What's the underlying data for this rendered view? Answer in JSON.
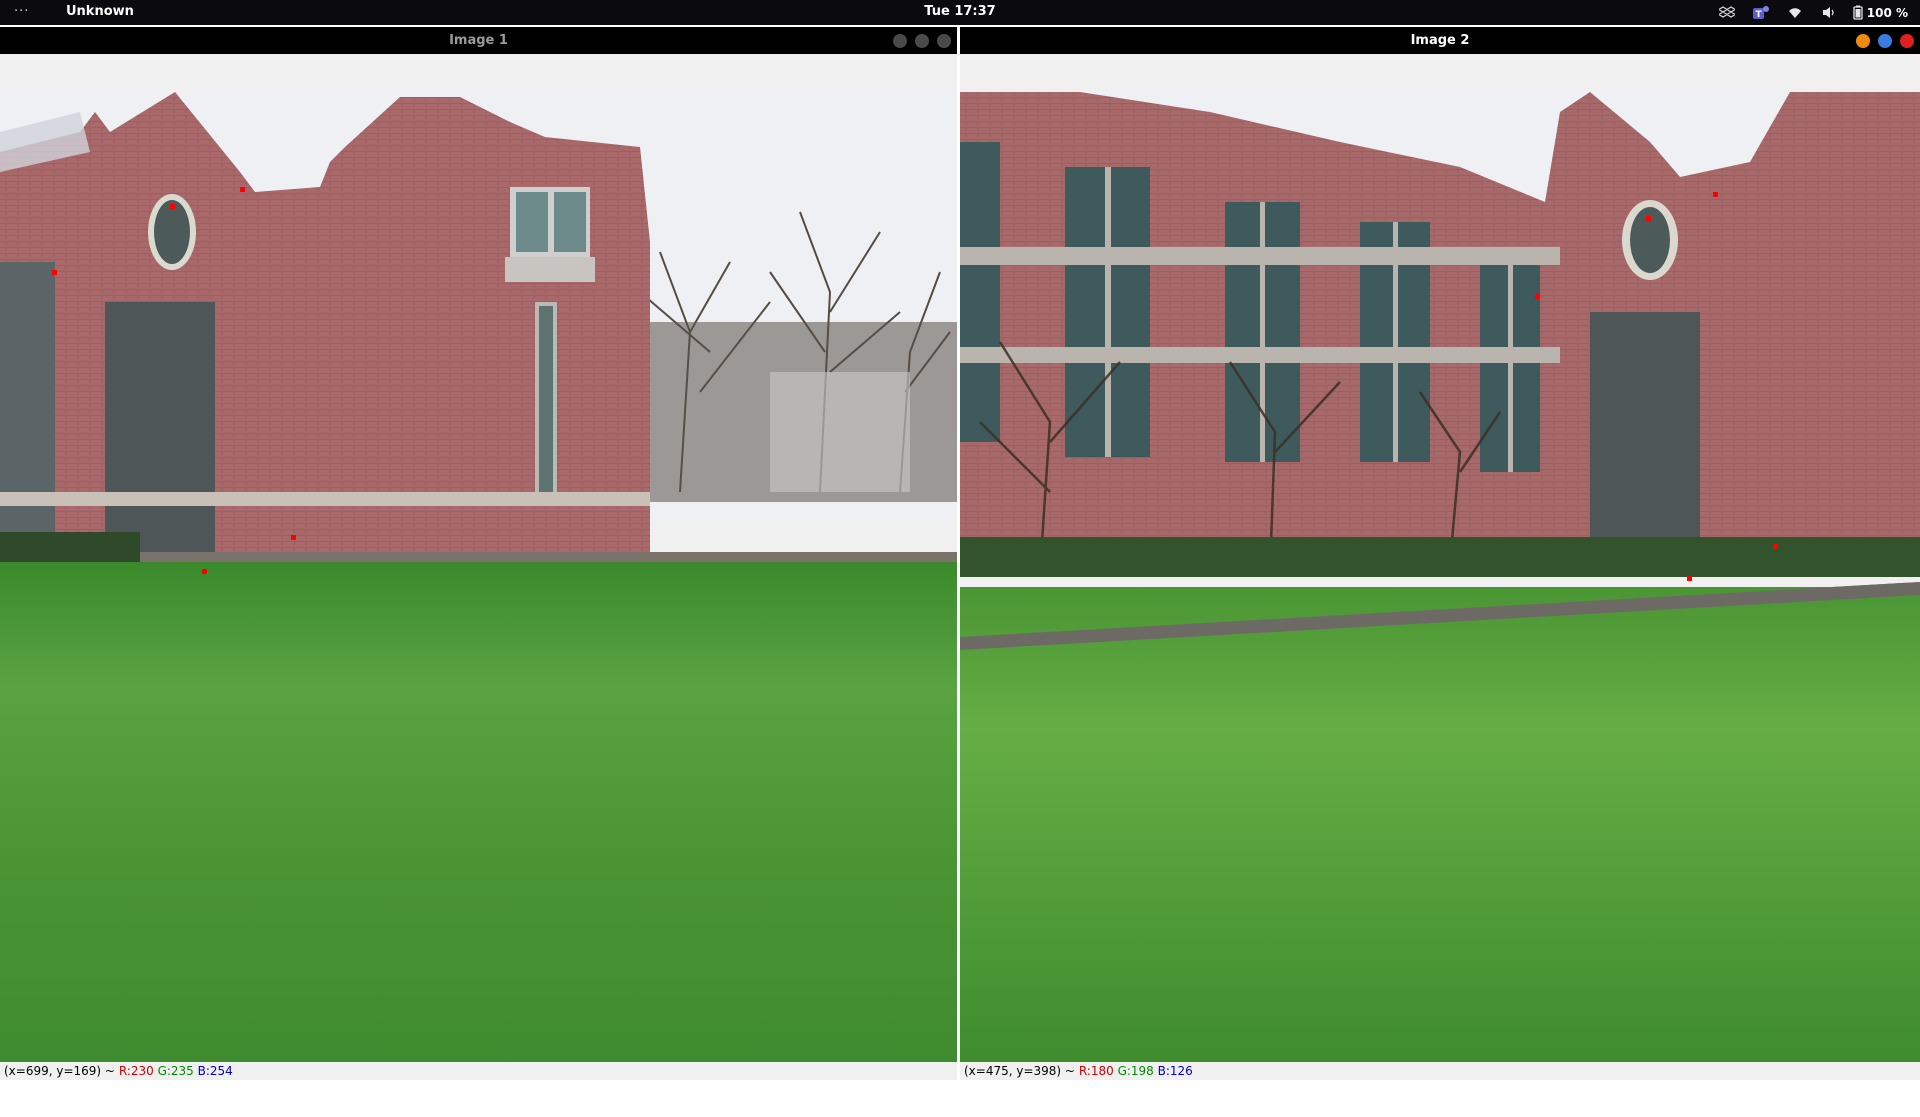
{
  "topbar": {
    "activities": "···",
    "app_title": "Unknown",
    "clock": "Tue 17:37",
    "battery": "100 %",
    "icons": [
      "dropbox-icon",
      "teams-icon",
      "wifi-icon",
      "volume-icon",
      "battery-icon"
    ]
  },
  "windows": [
    {
      "title": "Image 1",
      "active": false,
      "status": {
        "coords": "(x=699, y=169) ~",
        "r": "R:230",
        "g": "G:235",
        "b": "B:254"
      }
    },
    {
      "title": "Image 2",
      "active": true,
      "status": {
        "coords": "(x=475, y=398) ~",
        "r": "R:180",
        "g": "G:198",
        "b": "B:126"
      }
    }
  ],
  "colors": {
    "brick": "#a5686a",
    "grass": "#4f9a3a",
    "sky": "#eef0f4",
    "marker": "#ff0000",
    "win_close": "#e02020",
    "win_max": "#3a7de0",
    "win_min": "#f08a10"
  }
}
